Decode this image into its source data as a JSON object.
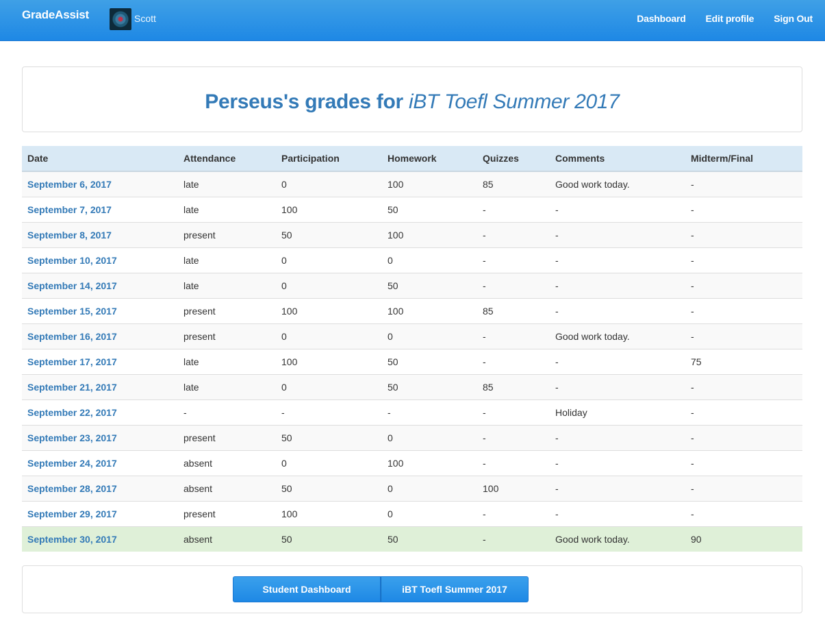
{
  "navbar": {
    "brand": "GradeAssist",
    "user_name": "Scott",
    "links": [
      "Dashboard",
      "Edit profile",
      "Sign Out"
    ]
  },
  "header": {
    "title_prefix": "Perseus's grades for ",
    "title_course": "iBT Toefl Summer 2017"
  },
  "table": {
    "columns": [
      "Date",
      "Attendance",
      "Participation",
      "Homework",
      "Quizzes",
      "Comments",
      "Midterm/Final"
    ],
    "rows": [
      [
        "September 6, 2017",
        "late",
        "0",
        "100",
        "85",
        "Good work today.",
        "-"
      ],
      [
        "September 7, 2017",
        "late",
        "100",
        "50",
        "-",
        "-",
        "-"
      ],
      [
        "September 8, 2017",
        "present",
        "50",
        "100",
        "-",
        "-",
        "-"
      ],
      [
        "September 10, 2017",
        "late",
        "0",
        "0",
        "-",
        "-",
        "-"
      ],
      [
        "September 14, 2017",
        "late",
        "0",
        "50",
        "-",
        "-",
        "-"
      ],
      [
        "September 15, 2017",
        "present",
        "100",
        "100",
        "85",
        "-",
        "-"
      ],
      [
        "September 16, 2017",
        "present",
        "0",
        "0",
        "-",
        "Good work today.",
        "-"
      ],
      [
        "September 17, 2017",
        "late",
        "100",
        "50",
        "-",
        "-",
        "75"
      ],
      [
        "September 21, 2017",
        "late",
        "0",
        "50",
        "85",
        "-",
        "-"
      ],
      [
        "September 22, 2017",
        "-",
        "-",
        "-",
        "-",
        "Holiday",
        "-"
      ],
      [
        "September 23, 2017",
        "present",
        "50",
        "0",
        "-",
        "-",
        "-"
      ],
      [
        "September 24, 2017",
        "absent",
        "0",
        "100",
        "-",
        "-",
        "-"
      ],
      [
        "September 28, 2017",
        "absent",
        "50",
        "0",
        "100",
        "-",
        "-"
      ],
      [
        "September 29, 2017",
        "present",
        "100",
        "0",
        "-",
        "-",
        "-"
      ],
      [
        "September 30, 2017",
        "absent",
        "50",
        "50",
        "-",
        "Good work today.",
        "90"
      ]
    ],
    "highlighted_row_index": 14,
    "highlight_color": "#dff0d8"
  },
  "footer": {
    "buttons": [
      "Student Dashboard",
      "iBT Toefl Summer 2017"
    ]
  },
  "colors": {
    "navbar": "#1e88e5",
    "link": "#337ab7",
    "table_header": "#d9e9f5"
  }
}
